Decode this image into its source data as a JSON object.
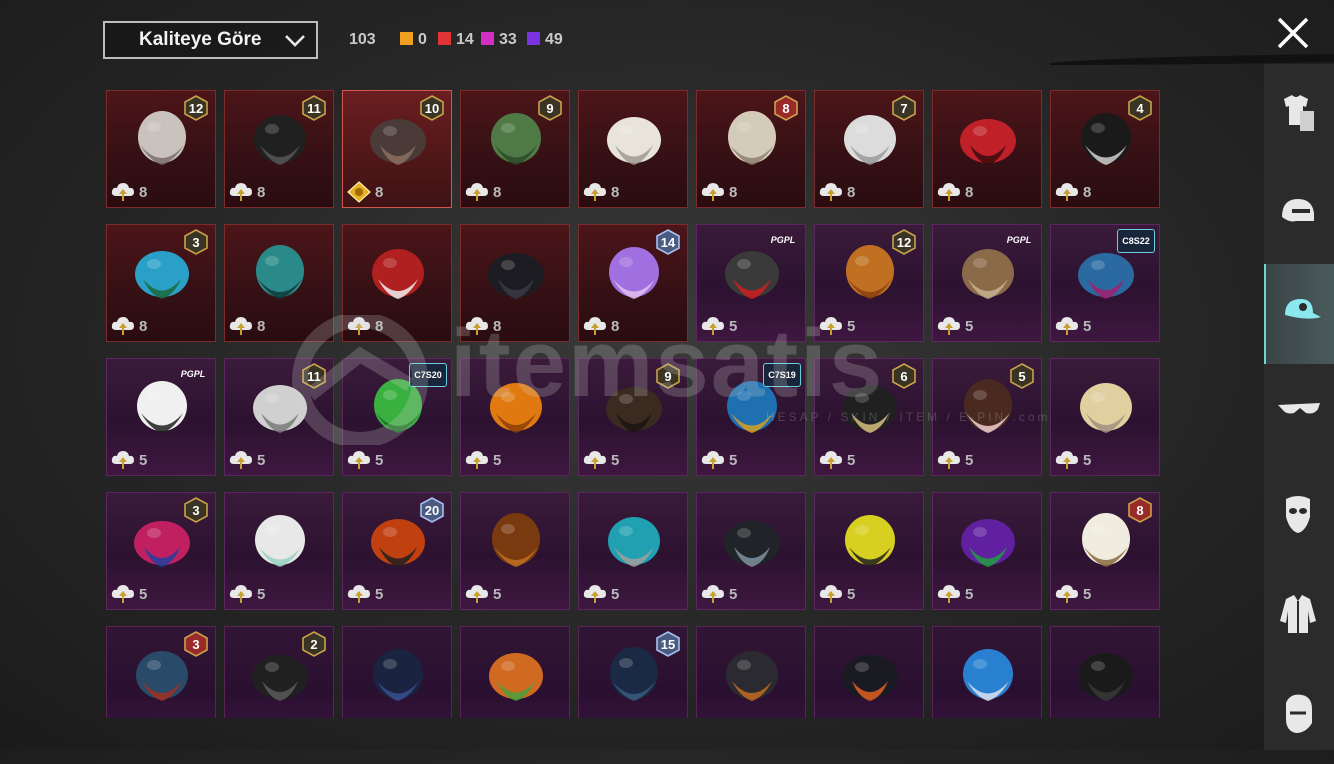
{
  "toolbar": {
    "sort_label": "Kaliteye Göre",
    "total_count": "103",
    "counts": [
      {
        "value": "0",
        "color": "#f0a020"
      },
      {
        "value": "14",
        "color": "#e03434"
      },
      {
        "value": "33",
        "color": "#d42fc4"
      },
      {
        "value": "49",
        "color": "#7a33e0"
      }
    ]
  },
  "watermark": {
    "brand": "itemsatis",
    "tagline": "HESAP / SKIN / ITEM / E-PIN .com"
  },
  "sidebar": {
    "categories": [
      {
        "icon": "outfit-icon",
        "active": false
      },
      {
        "icon": "helmet-icon",
        "active": false
      },
      {
        "icon": "cap-icon",
        "active": true
      },
      {
        "icon": "glasses-icon",
        "active": false
      },
      {
        "icon": "mask-icon",
        "active": false
      },
      {
        "icon": "jacket-icon",
        "active": false
      },
      {
        "icon": "character-face-icon",
        "active": false
      }
    ]
  },
  "items": [
    {
      "badge": "12",
      "count": "8",
      "rarity": "red",
      "icon": "white-hair-headpiece-icon"
    },
    {
      "badge": "11",
      "count": "8",
      "rarity": "red",
      "icon": "black-hood-icon"
    },
    {
      "badge": "10",
      "count": "8",
      "rarity": "red",
      "icon": "dark-hair-headpiece-icon",
      "selected": true,
      "currency": "gold"
    },
    {
      "badge": "9",
      "count": "8",
      "rarity": "red",
      "icon": "green-zombie-head-icon"
    },
    {
      "badge": "",
      "count": "8",
      "rarity": "red",
      "icon": "white-cowboy-hat-icon"
    },
    {
      "badge": "8",
      "count": "8",
      "rarity": "red",
      "icon": "silver-hair-icon"
    },
    {
      "badge": "7",
      "count": "8",
      "rarity": "red",
      "icon": "white-long-hair-icon"
    },
    {
      "badge": "",
      "count": "8",
      "rarity": "red",
      "icon": "red-helmet-icon"
    },
    {
      "badge": "4",
      "count": "8",
      "rarity": "red",
      "icon": "top-hat-snowman-icon"
    },
    {
      "badge": "3",
      "count": "8",
      "rarity": "red",
      "icon": "joker-head-icon"
    },
    {
      "badge": "",
      "count": "8",
      "rarity": "red",
      "icon": "teal-spiked-helmet-icon"
    },
    {
      "badge": "",
      "count": "8",
      "rarity": "red",
      "icon": "red-oni-mask-icon"
    },
    {
      "badge": "",
      "count": "8",
      "rarity": "red",
      "icon": "black-knight-helmet-icon"
    },
    {
      "badge": "14",
      "count": "8",
      "rarity": "red",
      "icon": "purple-hair-icon"
    },
    {
      "badge": "PGPL",
      "count": "5",
      "rarity": "purple",
      "icon": "sport-cap-icon"
    },
    {
      "badge": "12",
      "count": "5",
      "rarity": "purple",
      "icon": "orange-hair-icon"
    },
    {
      "badge": "PGPL",
      "count": "5",
      "rarity": "purple",
      "icon": "bull-head-icon"
    },
    {
      "badge": "C8S22",
      "count": "5",
      "rarity": "purple",
      "icon": "pink-teal-hair-icon"
    },
    {
      "badge": "PGPL",
      "count": "5",
      "rarity": "purple",
      "icon": "panda-head-icon"
    },
    {
      "badge": "11",
      "count": "5",
      "rarity": "purple",
      "icon": "flower-wreath-hair-icon"
    },
    {
      "badge": "C7S20",
      "count": "5",
      "rarity": "purple",
      "icon": "green-hair-icon"
    },
    {
      "badge": "",
      "count": "5",
      "rarity": "purple",
      "icon": "pumpkin-head-icon"
    },
    {
      "badge": "9",
      "count": "5",
      "rarity": "purple",
      "icon": "brown-hair-icon"
    },
    {
      "badge": "C7S19",
      "count": "5",
      "rarity": "purple",
      "icon": "blue-feather-helmet-icon"
    },
    {
      "badge": "6",
      "count": "5",
      "rarity": "purple",
      "icon": "gold-black-mask-icon"
    },
    {
      "badge": "5",
      "count": "5",
      "rarity": "purple",
      "icon": "bunny-ear-hair-icon"
    },
    {
      "badge": "",
      "count": "5",
      "rarity": "purple",
      "icon": "blonde-hat-hair-icon"
    },
    {
      "badge": "3",
      "count": "5",
      "rarity": "purple",
      "icon": "jester-hat-icon"
    },
    {
      "badge": "",
      "count": "5",
      "rarity": "purple",
      "icon": "white-pigtails-icon"
    },
    {
      "badge": "20",
      "count": "5",
      "rarity": "purple",
      "icon": "samurai-mask-icon"
    },
    {
      "badge": "",
      "count": "5",
      "rarity": "purple",
      "icon": "dinosaur-head-icon"
    },
    {
      "badge": "",
      "count": "5",
      "rarity": "purple",
      "icon": "robot-head-icon"
    },
    {
      "badge": "",
      "count": "5",
      "rarity": "purple",
      "icon": "horned-helmet-icon"
    },
    {
      "badge": "",
      "count": "5",
      "rarity": "purple",
      "icon": "yellow-moto-helmet-icon"
    },
    {
      "badge": "",
      "count": "5",
      "rarity": "purple",
      "icon": "purple-cyber-helmet-icon"
    },
    {
      "badge": "8",
      "count": "5",
      "rarity": "purple",
      "icon": "white-fedora-icon"
    },
    {
      "badge": "3",
      "count": "5",
      "rarity": "purple2",
      "icon": "ufo-hat-icon"
    },
    {
      "badge": "2",
      "count": "5",
      "rarity": "purple2",
      "icon": "black-braids-icon"
    },
    {
      "badge": "",
      "count": "5",
      "rarity": "purple2",
      "icon": "navy-helmet-icon"
    },
    {
      "badge": "",
      "count": "5",
      "rarity": "purple2",
      "icon": "frog-hat-icon"
    },
    {
      "badge": "15",
      "count": "5",
      "rarity": "purple2",
      "icon": "tactical-helmet-icon"
    },
    {
      "badge": "",
      "count": "5",
      "rarity": "purple2",
      "icon": "gasmask-helmet-icon"
    },
    {
      "badge": "",
      "count": "5",
      "rarity": "purple2",
      "icon": "orange-visor-helmet-icon"
    },
    {
      "badge": "",
      "count": "5",
      "rarity": "purple2",
      "icon": "blue-feather-crown-icon"
    },
    {
      "badge": "",
      "count": "5",
      "rarity": "purple2",
      "icon": "dark-hair-bun-icon"
    }
  ]
}
